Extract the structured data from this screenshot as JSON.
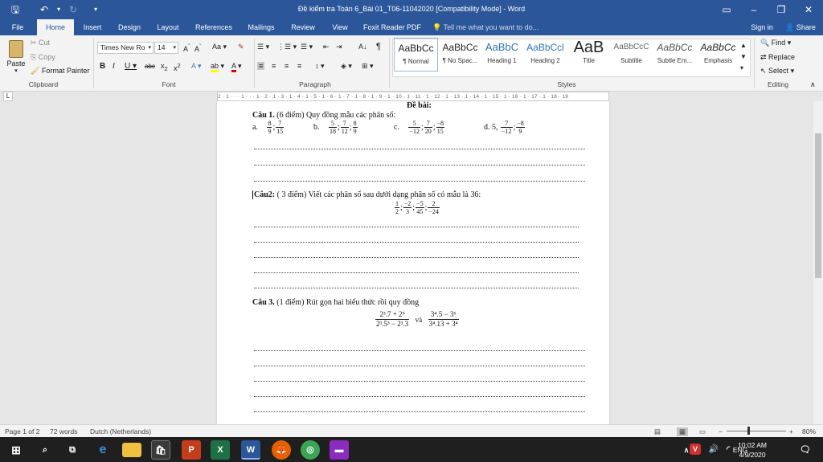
{
  "window": {
    "title": "Đề kiểm tra Toán 6_Bài 01_T06-11042020 [Compatibility Mode] - Word",
    "restore_icon": "restore-icon",
    "min_symbol": "–",
    "max_symbol": "❐",
    "close_symbol": "✕"
  },
  "tabs": [
    "File",
    "Home",
    "Insert",
    "Design",
    "Layout",
    "References",
    "Mailings",
    "Review",
    "View",
    "Foxit Reader PDF"
  ],
  "tell_me": "Tell me what you want to do...",
  "sign_in": "Sign in",
  "share": "Share",
  "clipboard": {
    "paste": "Paste",
    "cut": "Cut",
    "copy": "Copy",
    "format_painter": "Format Painter",
    "label": "Clipboard"
  },
  "font": {
    "family": "Times New Ro",
    "size": "14",
    "label": "Font"
  },
  "paragraph": {
    "label": "Paragraph"
  },
  "styles": {
    "label": "Styles",
    "items": [
      {
        "sample": "AaBbCc",
        "name": "¶ Normal"
      },
      {
        "sample": "AaBbCc",
        "name": "¶ No Spac..."
      },
      {
        "sample": "AaBbC",
        "name": "Heading 1"
      },
      {
        "sample": "AaBbCcl",
        "name": "Heading 2"
      },
      {
        "sample": "AaB",
        "name": "Title"
      },
      {
        "sample": "AaBbCcC",
        "name": "Subtitle"
      },
      {
        "sample": "AaBbCc",
        "name": "Subtle Em..."
      },
      {
        "sample": "AaBbCc",
        "name": "Emphasis"
      }
    ]
  },
  "editing": {
    "find": "Find",
    "replace": "Replace",
    "select": "Select",
    "label": "Editing"
  },
  "ruler": "2 · 1 · · · 1 · · · 1 · 2 · 1 · 3 · 1 · 4 · 1 · 5 · 1 · 6 · 1 · 7 · 1 · 8 · 1 · 9 · 1 · 10 · 1 · 11 · 1 · 12 · 1 · 13 · 1 · 14 · 1 · 15 · 1 · 16 · 1 · 17 · 1 · 18 · 19",
  "document": {
    "heading": "Đề bài:",
    "q1_title": "Câu 1.",
    "q1_text": "(6 điểm)  Quy đồng mẫu các phân số:",
    "q1_items": [
      {
        "label": "a.",
        "fracs": [
          [
            "8",
            "9"
          ],
          [
            "7",
            "15"
          ]
        ]
      },
      {
        "label": "b.",
        "fracs": [
          [
            "5",
            "18"
          ],
          [
            "7",
            "12"
          ],
          [
            "8",
            "9"
          ]
        ]
      },
      {
        "label": "c.",
        "fracs": [
          [
            "5",
            "−12"
          ],
          [
            "7",
            "20"
          ],
          [
            "−8",
            "15"
          ]
        ]
      },
      {
        "label": "d. 5,",
        "fracs": [
          [
            "7",
            "−12"
          ],
          [
            "−8",
            "9"
          ]
        ]
      }
    ],
    "q2_title": "Câu2:",
    "q2_text": "( 3 điểm) Viết các phân số sau dưới dạng phân số có mẫu là 36:",
    "q2_fracs": [
      [
        "1",
        "2"
      ],
      [
        "−2",
        "3"
      ],
      [
        "−5",
        "45"
      ],
      [
        "2",
        "−24"
      ]
    ],
    "q3_title": "Câu 3.",
    "q3_text": "(1 điểm) Rút gọn hai biểu thức rồi quy đồng",
    "q3_expr1_num": "2³.7 + 2⁵",
    "q3_expr1_den": "2³.5³ − 2³.3",
    "q3_and": "và",
    "q3_expr2_num": "3⁴.5 − 3⁶",
    "q3_expr2_den": "3⁴.13 + 3⁴"
  },
  "status": {
    "page": "Page 1 of 2",
    "words": "72 words",
    "language": "Dutch (Netherlands)",
    "zoom": "80%"
  },
  "clock": {
    "time": "10:02 AM",
    "date": "4/9/2020"
  },
  "tray": {
    "lang": "ENG"
  }
}
